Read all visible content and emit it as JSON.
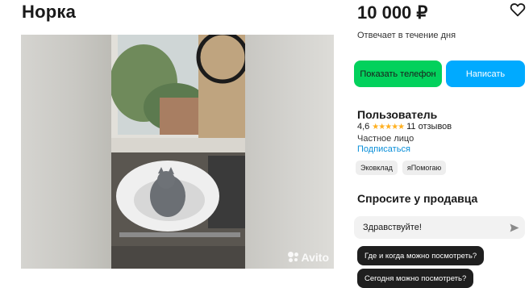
{
  "listing": {
    "title": "Норка",
    "price": "10 000 ₽",
    "reply_time": "Отвечает в течение дня"
  },
  "actions": {
    "phone_label": "Показать телефон",
    "message_label": "Написать"
  },
  "gallery": {
    "watermark": "Avito"
  },
  "seller": {
    "name": "Пользователь",
    "rating": "4,6",
    "stars": 4.6,
    "reviews": "11 отзывов",
    "type": "Частное лицо",
    "subscribe_label": "Подписаться",
    "tags": [
      "Эковклад",
      "яПомогаю"
    ]
  },
  "ask": {
    "title": "Спросите у продавца",
    "input_value": "Здравствуйте!",
    "quick_questions": [
      "Где и когда можно посмотреть?",
      "Сегодня можно посмотреть?"
    ]
  },
  "colors": {
    "phone_button": "#02d15c",
    "message_button": "#00aaff",
    "link": "#0a8fd9",
    "star": "#ffb021"
  },
  "icons": [
    "heart-icon",
    "star-icon",
    "send-icon",
    "avito-logo-icon"
  ]
}
